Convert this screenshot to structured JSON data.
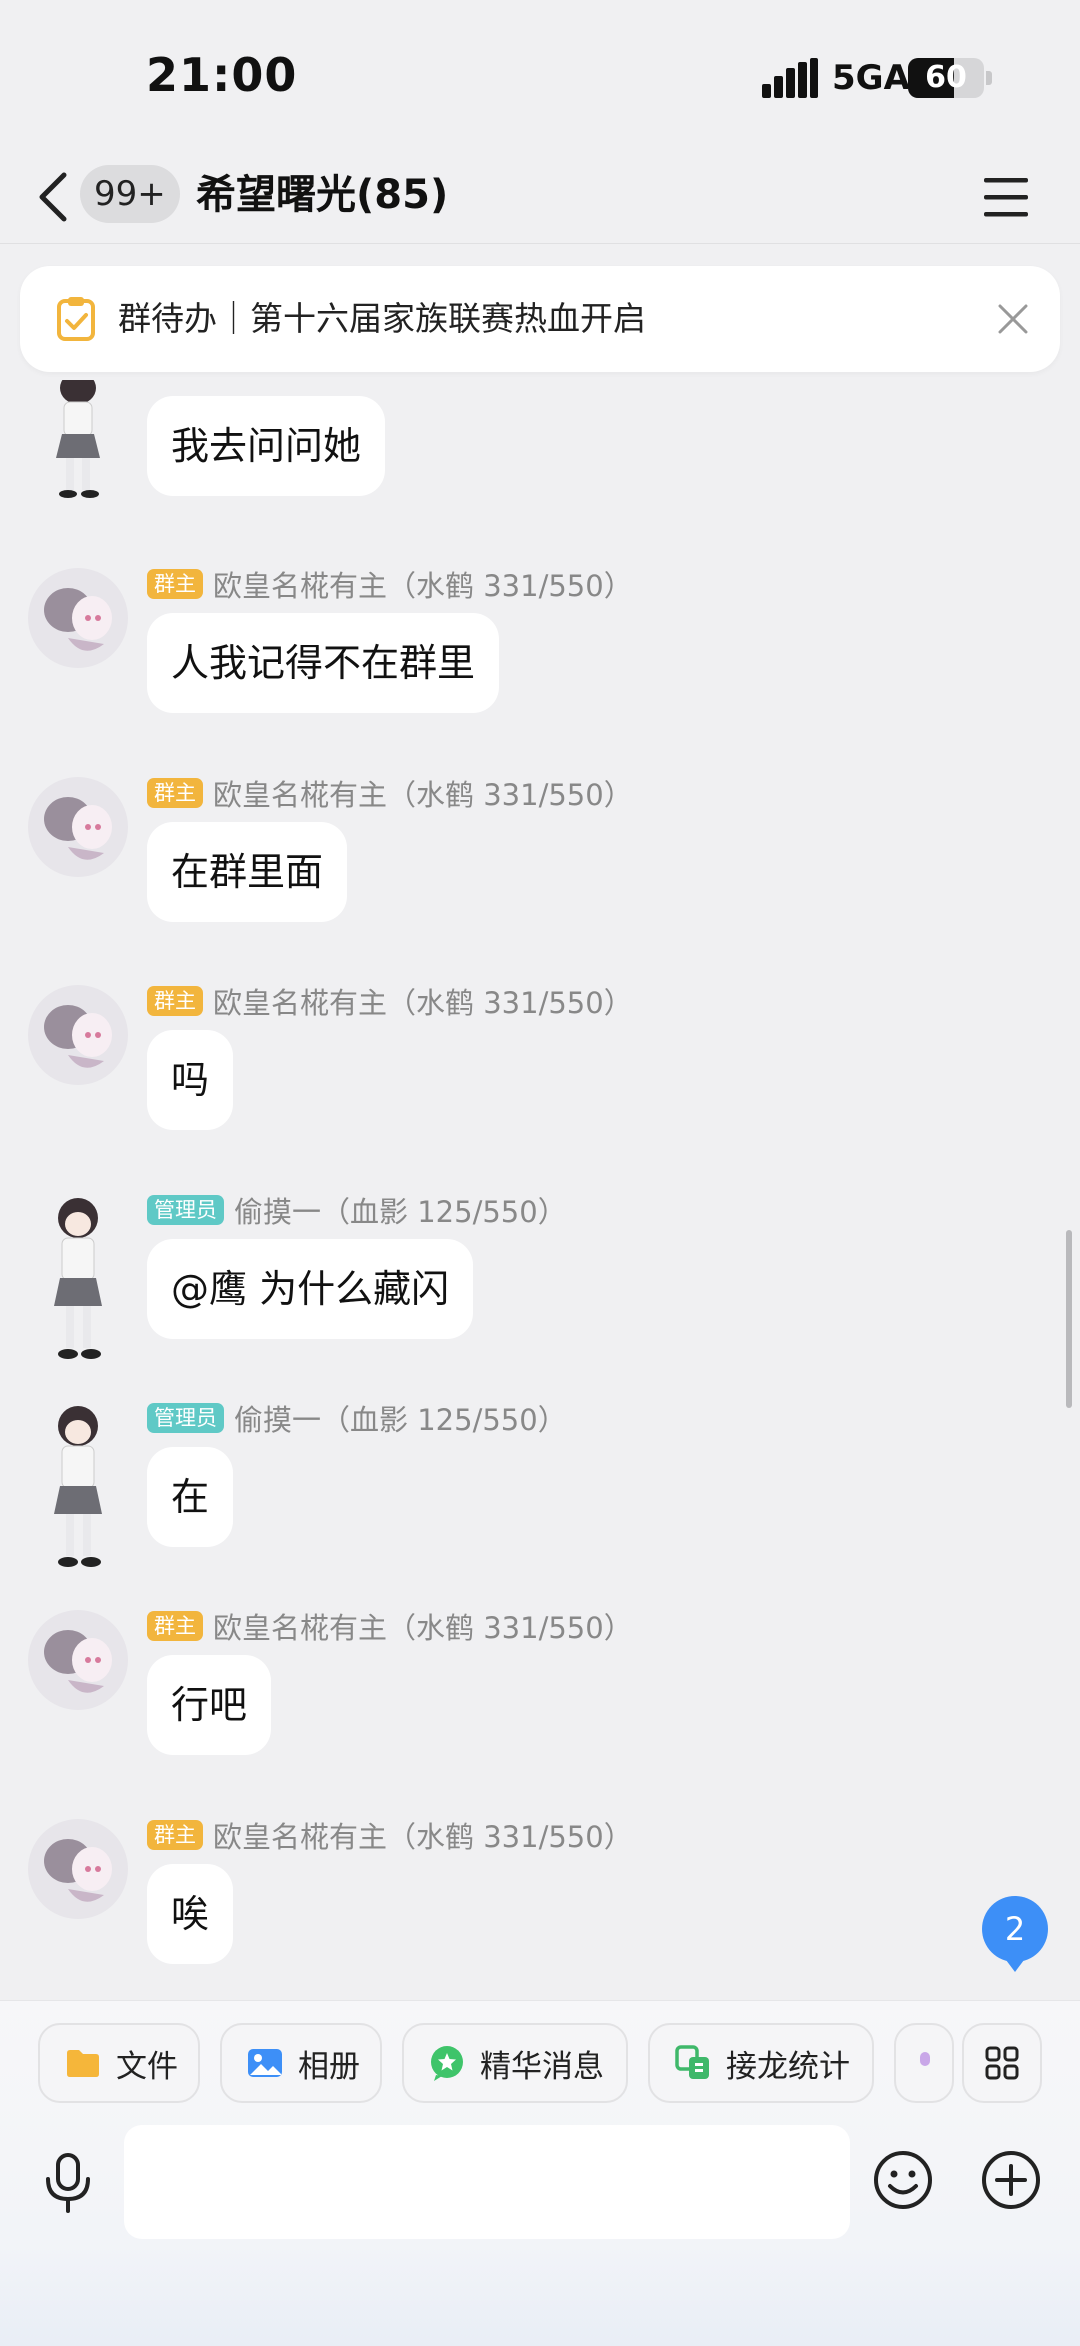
{
  "status_bar": {
    "time": "21:00",
    "network": "5GA",
    "battery": "60",
    "battery_level": 0.6
  },
  "nav": {
    "unread_count": "99+",
    "title": "希望曙光(85)"
  },
  "todo_banner": {
    "text": "群待办｜第十六届家族联赛热血开启"
  },
  "messages": [
    {
      "avatar": "girl-avatar",
      "role": "",
      "name": "",
      "text": "我去问问她"
    },
    {
      "avatar": "anime-avatar",
      "role": "群主",
      "name": "欧皇名椛有主（水鹤 331/550）",
      "text": "人我记得不在群里"
    },
    {
      "avatar": "anime-avatar",
      "role": "群主",
      "name": "欧皇名椛有主（水鹤 331/550）",
      "text": "在群里面"
    },
    {
      "avatar": "anime-avatar",
      "role": "群主",
      "name": "欧皇名椛有主（水鹤 331/550）",
      "text": "吗"
    },
    {
      "avatar": "girl-avatar",
      "role": "管理员",
      "name": "偷摸一（血影 125/550）",
      "text": "@鹰 为什么藏闪"
    },
    {
      "avatar": "girl-avatar",
      "role": "管理员",
      "name": "偷摸一（血影 125/550）",
      "text": "在"
    },
    {
      "avatar": "anime-avatar",
      "role": "群主",
      "name": "欧皇名椛有主（水鹤 331/550）",
      "text": "行吧"
    },
    {
      "avatar": "anime-avatar",
      "role": "群主",
      "name": "欧皇名椛有主（水鹤 331/550）",
      "text": "唉"
    }
  ],
  "new_message_badge": "2",
  "quick_actions": [
    {
      "label": "文件",
      "icon": "folder-icon",
      "color": "#f5b63a"
    },
    {
      "label": "相册",
      "icon": "photo-icon",
      "color": "#3d8ff7"
    },
    {
      "label": "精华消息",
      "icon": "star-bubble-icon",
      "color": "#3fc46a"
    },
    {
      "label": "接龙统计",
      "icon": "relay-icon",
      "color": "#3fb86a"
    }
  ],
  "input": {
    "placeholder": "",
    "value": ""
  },
  "colors": {
    "owner_tag": "#f2b53d",
    "admin_tag": "#5fc9c6",
    "accent": "#3d8ff7"
  }
}
